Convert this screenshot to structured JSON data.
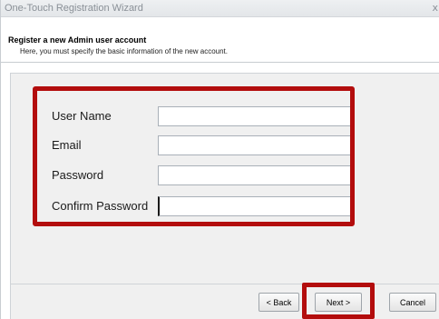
{
  "window": {
    "title": "One-Touch Registration Wizard",
    "close_glyph": "x"
  },
  "header": {
    "title": "Register a new Admin user account",
    "subtitle": "Here, you must specify the basic information of the new account."
  },
  "form": {
    "fields": [
      {
        "label": "User Name",
        "value": ""
      },
      {
        "label": "Email",
        "value": ""
      },
      {
        "label": "Password",
        "value": ""
      },
      {
        "label": "Confirm Password",
        "value": ""
      }
    ]
  },
  "buttons": {
    "back": "< Back",
    "next": "Next >",
    "cancel": "Cancel"
  },
  "colors": {
    "highlight": "#b30d0d",
    "panel": "#f0f0f0"
  }
}
